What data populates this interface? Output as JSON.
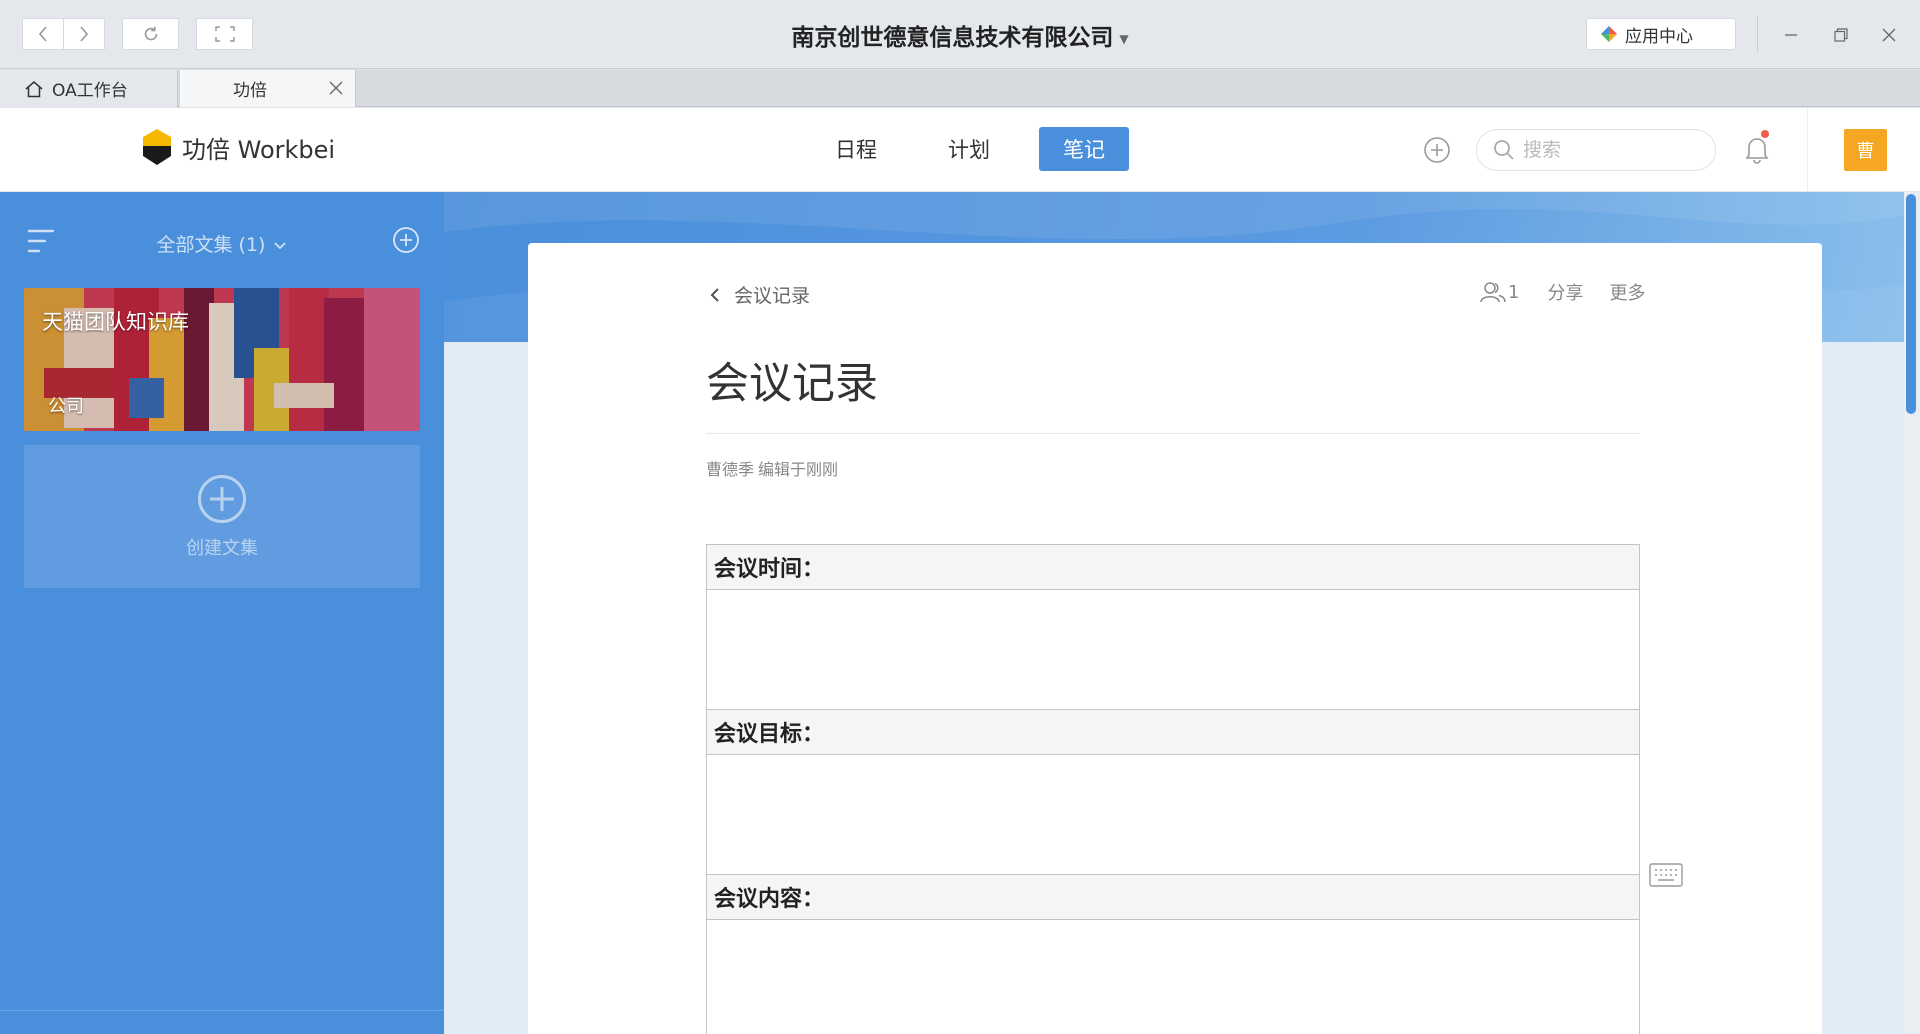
{
  "window": {
    "title": "南京创世德意信息技术有限公司",
    "app_center": "应用中心"
  },
  "tabs": [
    {
      "label": "OA工作台",
      "icon": "home-icon"
    },
    {
      "label": "功倍",
      "icon": "close-icon"
    }
  ],
  "header": {
    "brand": "功倍 Workbei",
    "nav": [
      {
        "label": "日程",
        "active": false
      },
      {
        "label": "计划",
        "active": false
      },
      {
        "label": "笔记",
        "active": true
      }
    ],
    "search_placeholder": "搜索",
    "avatar": "曹"
  },
  "sidebar": {
    "title": "全部文集 (1)",
    "collections": [
      {
        "name": "天猫团队知识库",
        "type": "公司"
      }
    ],
    "create_label": "创建文集"
  },
  "document": {
    "breadcrumb": "会议记录",
    "member_count": "1",
    "share": "分享",
    "more": "更多",
    "title": "会议记录",
    "meta_author": "曹德季",
    "meta_edit": "编辑于刚刚",
    "sections": [
      "会议时间：",
      "会议目标：",
      "会议内容："
    ]
  },
  "colors": {
    "accent": "#4a8fdb",
    "avatar_bg": "#f5a623",
    "notification_dot": "#f45b4f"
  }
}
